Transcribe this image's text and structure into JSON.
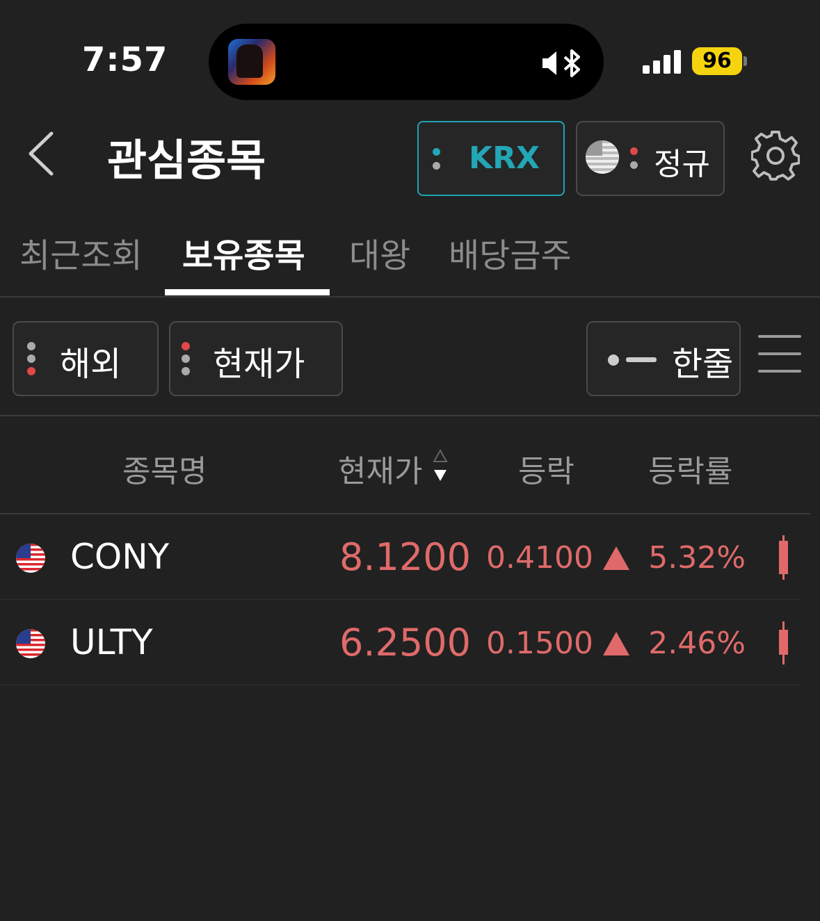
{
  "status_bar": {
    "time": "7:57",
    "battery": "96"
  },
  "header": {
    "title": "관심종목",
    "market_chip": "KRX",
    "session_chip": "정규"
  },
  "tabs": [
    {
      "label": "최근조회",
      "active": false
    },
    {
      "label": "보유종목",
      "active": true
    },
    {
      "label": "대왕",
      "active": false
    },
    {
      "label": "배당금주",
      "active": false
    }
  ],
  "filters": {
    "region": "해외",
    "sort_field": "현재가",
    "view_mode": "한줄"
  },
  "columns": [
    "종목명",
    "현재가",
    "등락",
    "등락률"
  ],
  "stocks": [
    {
      "symbol": "CONY",
      "price": "8.1200",
      "change": "0.4100",
      "change_pct": "5.32%",
      "direction": "up"
    },
    {
      "symbol": "ULTY",
      "price": "6.2500",
      "change": "0.1500",
      "change_pct": "2.46%",
      "direction": "up"
    }
  ],
  "colors": {
    "accent": "#23a6b5",
    "up": "#e06a6a",
    "background": "#212121"
  }
}
